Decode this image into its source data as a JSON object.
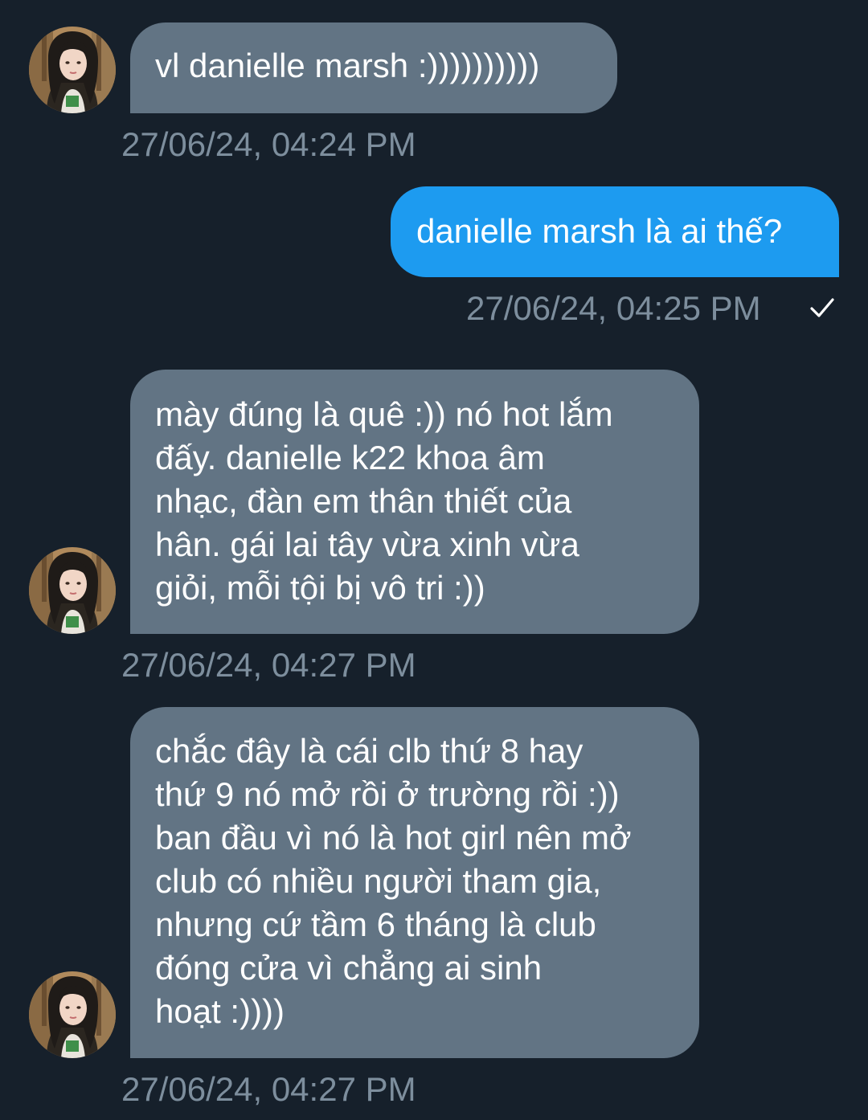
{
  "colors": {
    "background": "#16202b",
    "incoming_bubble": "#627484",
    "outgoing_bubble": "#1d9bf0",
    "timestamp": "#7d8e9d"
  },
  "messages": [
    {
      "direction": "incoming",
      "text": "vl danielle marsh :))))))))))",
      "timestamp": "27/06/24, 04:24 PM",
      "avatar": "contact-avatar"
    },
    {
      "direction": "outgoing",
      "text": "danielle marsh là ai thế?",
      "timestamp": "27/06/24, 04:25 PM",
      "status_icon": "check-icon"
    },
    {
      "direction": "incoming",
      "text": "mày đúng là quê :)) nó hot lắm\nđấy. danielle k22 khoa âm\nnhạc, đàn em thân thiết của\nhân. gái lai tây vừa xinh vừa\ngiỏi, mỗi tội bị vô tri :))",
      "timestamp": "27/06/24, 04:27 PM",
      "avatar": "contact-avatar"
    },
    {
      "direction": "incoming",
      "text": "chắc đây là cái clb thứ 8 hay\nthứ 9 nó mở rồi ở trường rồi :))\nban đầu vì nó là hot girl nên mở\nclub có nhiều người tham gia,\nnhưng cứ tầm 6 tháng là club\nđóng cửa vì chẳng ai sinh\nhoạt :))))",
      "timestamp": "27/06/24, 04:27 PM",
      "avatar": "contact-avatar"
    }
  ]
}
